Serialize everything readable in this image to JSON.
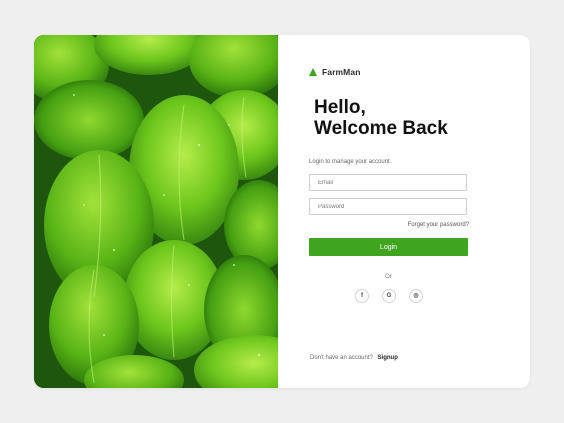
{
  "brand": {
    "name": "FarmMan",
    "icon": "triangle-logo-icon",
    "accent": "#3fa51e"
  },
  "heading": {
    "line1": "Hello,",
    "line2": "Welcome Back"
  },
  "subtitle": "Login to manage your account.",
  "form": {
    "email_placeholder": "Email",
    "password_placeholder": "Password",
    "forgot_label": "Forget your password?",
    "login_label": "Login"
  },
  "divider_label": "Or",
  "social": [
    {
      "icon": "facebook-icon",
      "glyph": "f"
    },
    {
      "icon": "google-icon",
      "glyph": "G"
    },
    {
      "icon": "instagram-icon",
      "glyph": "◎"
    }
  ],
  "footer": {
    "prompt": "Don't have an account?",
    "signup_label": "Signup"
  }
}
